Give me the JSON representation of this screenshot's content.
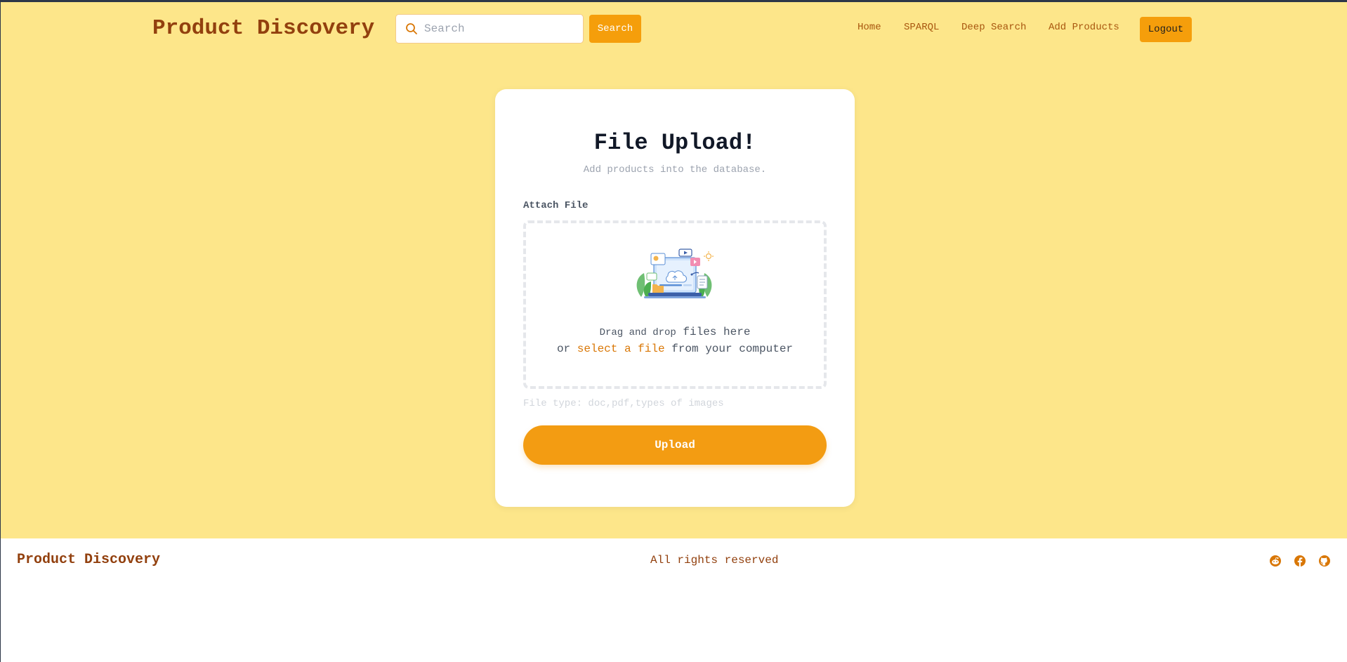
{
  "header": {
    "brand": "Product Discovery",
    "search": {
      "placeholder": "Search",
      "value": "",
      "button_label": "Search"
    },
    "nav": [
      "Home",
      "SPARQL",
      "Deep Search",
      "Add Products"
    ],
    "logout_label": "Logout"
  },
  "upload_card": {
    "title": "File Upload!",
    "subtitle": "Add products into the database.",
    "attach_label": "Attach File",
    "dropzone": {
      "line1_small": "Drag and drop",
      "line1_rest": " files here",
      "line2_prefix": "or ",
      "line2_link": "select a file",
      "line2_suffix": " from your computer"
    },
    "file_type_hint": "File type: doc,pdf,types of images",
    "upload_label": "Upload"
  },
  "footer": {
    "brand": "Product Discovery",
    "rights": "All rights reserved",
    "social_icons": [
      "reddit-icon",
      "facebook-icon",
      "github-icon"
    ]
  },
  "colors": {
    "page_background": "#fde68a",
    "accent": "#f59e0b",
    "brand_text": "#92400e",
    "link": "#d97706"
  }
}
